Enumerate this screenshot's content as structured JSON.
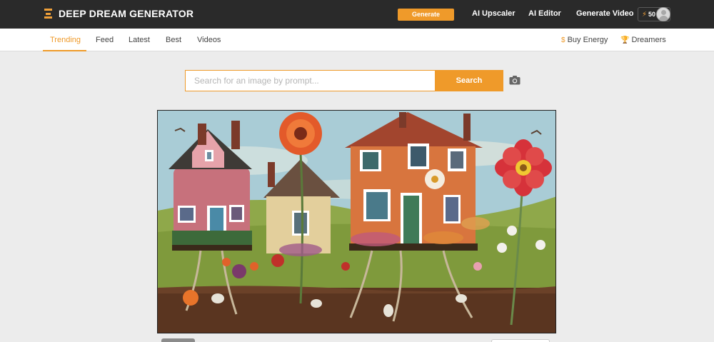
{
  "header": {
    "brand": "DEEP DREAM GENERATOR",
    "generate_label": "Generate",
    "nav": [
      "AI Upscaler",
      "AI Editor",
      "Generate Video"
    ],
    "energy": "50"
  },
  "subnav": {
    "tabs": [
      "Trending",
      "Feed",
      "Latest",
      "Best",
      "Videos"
    ],
    "active_tab": "Trending",
    "buy_energy": "Buy Energy",
    "dreamers": "Dreamers"
  },
  "search": {
    "placeholder": "Search for an image by prompt...",
    "value": "",
    "button_label": "Search"
  },
  "colors": {
    "accent": "#ef9a2a",
    "topbar": "#2a2a2a"
  },
  "icons": [
    "logo-icon",
    "bolt-icon",
    "avatar-icon",
    "dollar-icon",
    "trophy-icon",
    "camera-icon"
  ]
}
